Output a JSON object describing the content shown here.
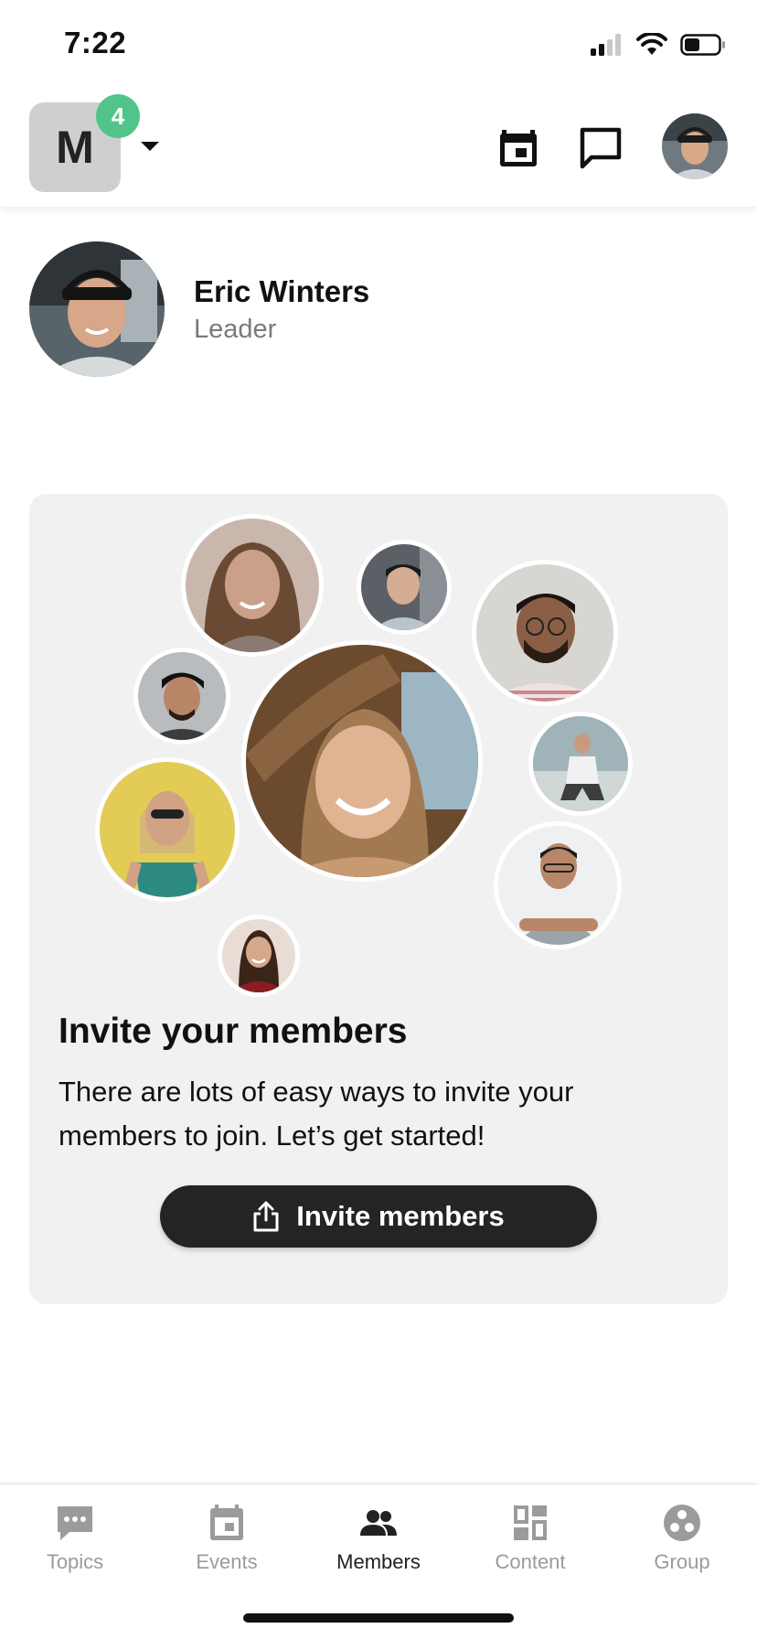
{
  "status_bar": {
    "time": "7:22"
  },
  "header": {
    "group_initial": "M",
    "group_badge": "4",
    "icons": {
      "calendar": "calendar-icon",
      "chat": "chat-icon"
    }
  },
  "leader": {
    "name": "Eric Winters",
    "role": "Leader"
  },
  "invite": {
    "title": "Invite your members",
    "body": "There are lots of easy ways to invite your members to join. Let’s get started!",
    "button_label": "Invite members",
    "button_icon": "share-icon"
  },
  "tabs": [
    {
      "label": "Topics",
      "icon": "topics-icon",
      "active": false
    },
    {
      "label": "Events",
      "icon": "events-icon",
      "active": false
    },
    {
      "label": "Members",
      "icon": "members-icon",
      "active": true
    },
    {
      "label": "Content",
      "icon": "content-icon",
      "active": false
    },
    {
      "label": "Group",
      "icon": "group-icon",
      "active": false
    }
  ],
  "colors": {
    "badge": "#52c48a",
    "button": "#232423",
    "card": "#f1f1f1",
    "inactive_tab": "#9b9b9b"
  }
}
